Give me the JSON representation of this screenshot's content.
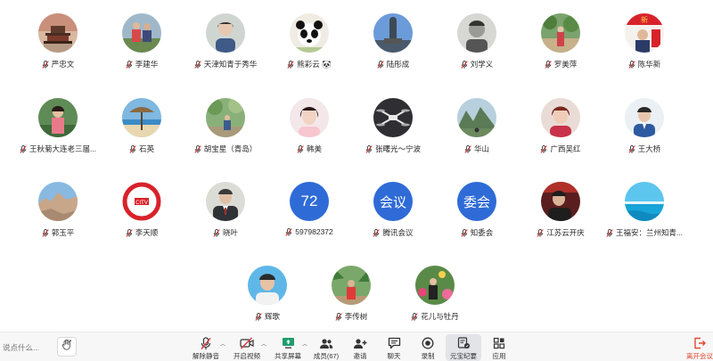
{
  "participants_rows": [
    [
      {
        "name": "严忠文",
        "avatar": "temple"
      },
      {
        "name": "李建华",
        "avatar": "people"
      },
      {
        "name": "天津知青于秀华",
        "avatar": "portrait-light"
      },
      {
        "name": "熊彩云 🐼",
        "avatar": "panda"
      },
      {
        "name": "陆彤成",
        "avatar": "statue"
      },
      {
        "name": "刘学义",
        "avatar": "bw-portrait"
      },
      {
        "name": "罗美萍",
        "avatar": "garden"
      },
      {
        "name": "陈华新",
        "avatar": "poster"
      }
    ],
    [
      {
        "name": "王秋菊大连老三届...",
        "avatar": "woman-green"
      },
      {
        "name": "石英",
        "avatar": "umbrella"
      },
      {
        "name": "胡宝星（青岛）",
        "avatar": "park"
      },
      {
        "name": "韩美",
        "avatar": "woman-pink"
      },
      {
        "name": "张曙光～宁波",
        "avatar": "drone"
      },
      {
        "name": "华山",
        "avatar": "mountain"
      },
      {
        "name": "广西吴红",
        "avatar": "woman-red"
      },
      {
        "name": "王大桥",
        "avatar": "man-blue"
      }
    ],
    [
      {
        "name": "郭玉平",
        "avatar": "rocks"
      },
      {
        "name": "李天顺",
        "avatar": "ctv-logo"
      },
      {
        "name": "晓叶",
        "avatar": "man-suit"
      },
      {
        "name": "597982372",
        "avatar": "text",
        "text": "72",
        "color": "#2f6bd6"
      },
      {
        "name": "腾讯会议",
        "avatar": "text",
        "text": "会议",
        "color": "#2f6bd6"
      },
      {
        "name": "知委会",
        "avatar": "text",
        "text": "委会",
        "color": "#2f6bd6"
      },
      {
        "name": "江苏云开庆",
        "avatar": "man-stage"
      },
      {
        "name": "王福安：兰州知青...",
        "avatar": "sea"
      }
    ],
    [
      {
        "name": "辉歌",
        "avatar": "man-sky"
      },
      {
        "name": "李传树",
        "avatar": "man-palm"
      },
      {
        "name": "花儿与牡丹",
        "avatar": "woman-flowers"
      }
    ]
  ],
  "toolbar": {
    "chat_placeholder": "说点什么...",
    "unmute": "解除静音",
    "start_video": "开启视频",
    "share_screen": "共享屏幕",
    "members": "成员(67)",
    "invite": "邀请",
    "chat": "聊天",
    "record": "录制",
    "minutes": "元宝纪要",
    "apps": "应用",
    "leave": "离开会议"
  },
  "colors": {
    "accent_blue": "#2f6bd6",
    "leave_red": "#e24a2f",
    "muted_mic_red": "#d93a3a"
  }
}
